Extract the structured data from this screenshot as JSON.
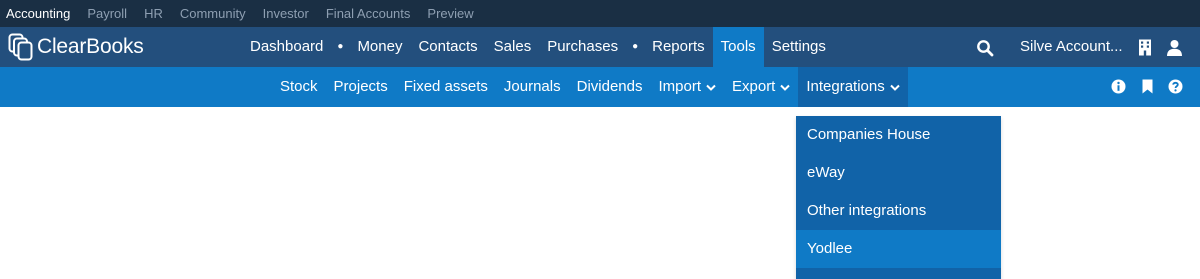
{
  "product_tabs": [
    {
      "label": "Accounting",
      "active": true
    },
    {
      "label": "Payroll"
    },
    {
      "label": "HR"
    },
    {
      "label": "Community"
    },
    {
      "label": "Investor"
    },
    {
      "label": "Final Accounts"
    },
    {
      "label": "Preview"
    }
  ],
  "brand": {
    "name": "ClearBooks"
  },
  "main_nav": {
    "dashboard": "Dashboard",
    "money": "Money",
    "contacts": "Contacts",
    "sales": "Sales",
    "purchases": "Purchases",
    "reports": "Reports",
    "tools": "Tools",
    "settings": "Settings",
    "active": "Tools",
    "separator": "●"
  },
  "account": {
    "label": "Silve Account..."
  },
  "sub_nav": {
    "stock": "Stock",
    "projects": "Projects",
    "fixed_assets": "Fixed assets",
    "journals": "Journals",
    "dividends": "Dividends",
    "import": "Import",
    "export": "Export",
    "integrations": "Integrations",
    "open": "Integrations"
  },
  "integrations_menu": [
    {
      "label": "Companies House"
    },
    {
      "label": "eWay"
    },
    {
      "label": "Other integrations"
    },
    {
      "label": "Yodlee",
      "highlighted": true
    }
  ],
  "icons": {
    "search": "search-icon",
    "building": "building-icon",
    "user": "user-icon",
    "info": "info-icon",
    "bookmark": "bookmark-icon",
    "help": "help-icon",
    "caret": "chevron-down-icon"
  },
  "colors": {
    "topbar": "#1a2f44",
    "mainbar": "#234f7d",
    "accent": "#0f7ac6",
    "dropdown": "#1163a8"
  }
}
